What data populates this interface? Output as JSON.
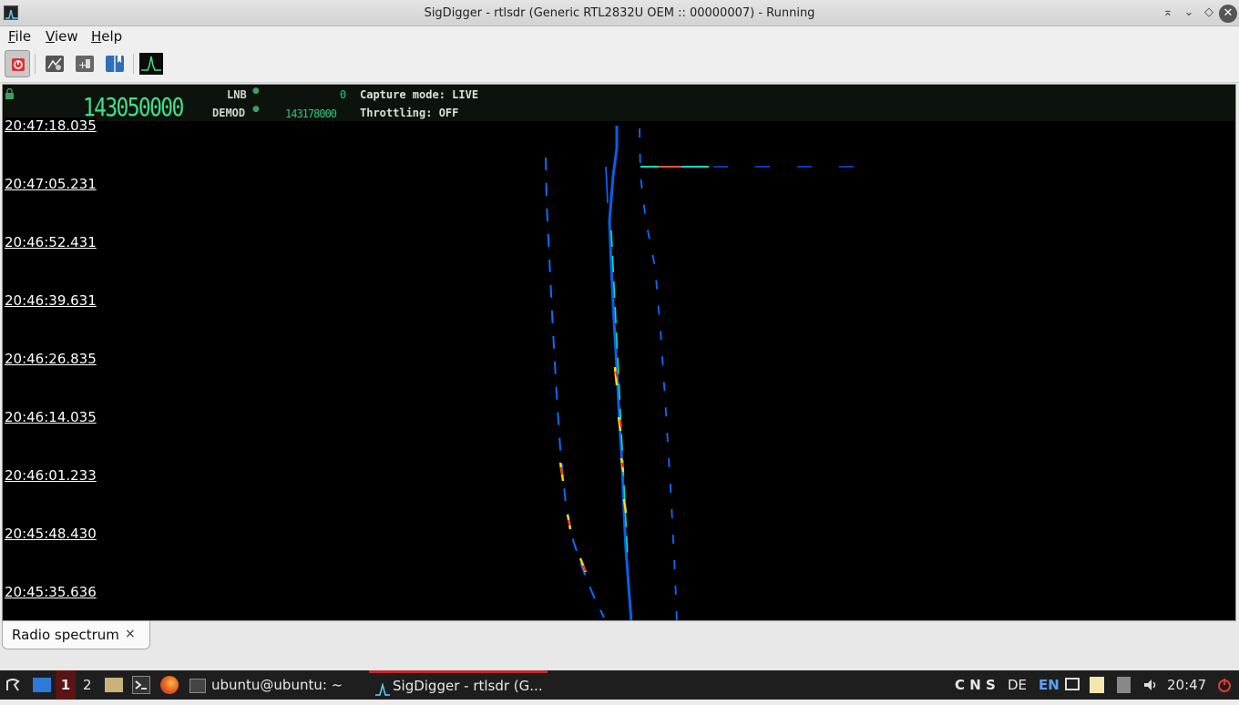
{
  "window": {
    "title": "SigDigger - rtlsdr (Generic RTL2832U OEM :: 00000007) - Running"
  },
  "menu": {
    "items": [
      {
        "first": "F",
        "rest": "ile"
      },
      {
        "first": "V",
        "rest": "iew"
      },
      {
        "first": "H",
        "rest": "elp"
      }
    ]
  },
  "toolbar": {
    "icons": [
      "power-toggle-icon",
      "settings-icon",
      "add-bookmark-icon",
      "bookmarks-icon",
      "spectrum-icon"
    ]
  },
  "tuner": {
    "frequency": "143050000",
    "lnb_label": "LNB",
    "lnb_value": "0",
    "demod_label": "DEMOD",
    "demod_value": "143178000",
    "capture_mode": "Capture mode: LIVE",
    "throttling": "Throttling: OFF"
  },
  "waterfall": {
    "timestamps": [
      "20:47:18.035",
      "20:47:05.231",
      "20:46:52.431",
      "20:46:39.631",
      "20:46:26.835",
      "20:46:14.035",
      "20:46:01.233",
      "20:45:48.430",
      "20:45:35.636"
    ],
    "colors": {
      "low": "#0030ff",
      "mid": "#00ffd0",
      "high": "#ffe000",
      "peak": "#ff2020"
    }
  },
  "tabs": [
    {
      "label": "Radio spectrum",
      "close": "×"
    }
  ],
  "taskbar": {
    "workspace_1": "1",
    "workspace_2": "2",
    "terminal_task": "ubuntu@ubuntu: ~",
    "sigdigger_task": "SigDigger - rtlsdr (G...",
    "tray_letters": "C N S",
    "layout_de": "DE",
    "layout_en": "EN",
    "clock": "20:47"
  }
}
